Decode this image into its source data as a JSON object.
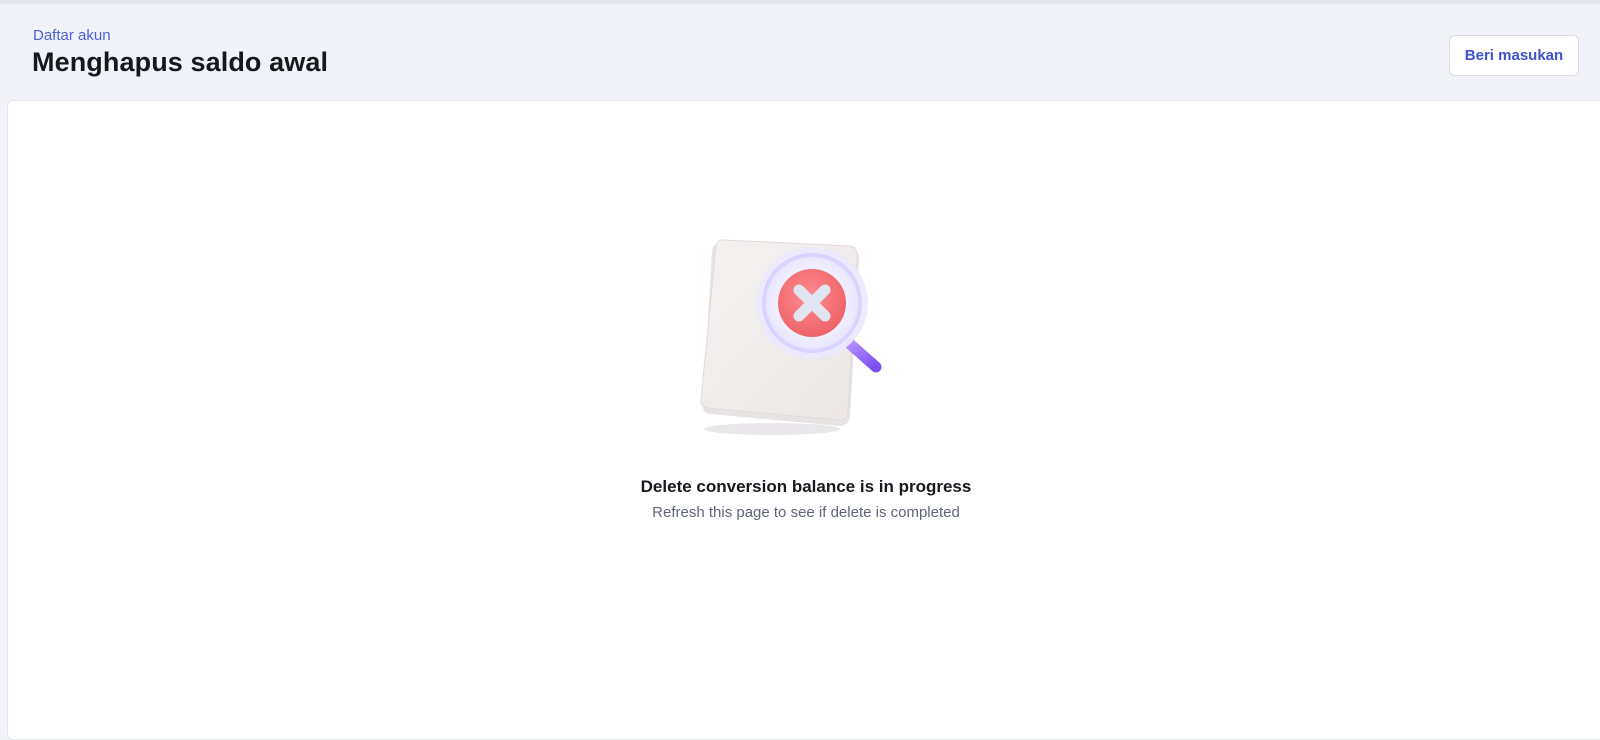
{
  "header": {
    "breadcrumb": "Daftar akun",
    "title": "Menghapus saldo awal",
    "feedback_button": "Beri masukan"
  },
  "empty_state": {
    "illustration_icon": "document-search-error-icon",
    "title": "Delete conversion balance is in progress",
    "subtitle": "Refresh this page to see if delete is completed"
  },
  "colors": {
    "accent": "#3d52cf",
    "error": "#f0555a",
    "magnifier_handle": "#8f63f0"
  }
}
